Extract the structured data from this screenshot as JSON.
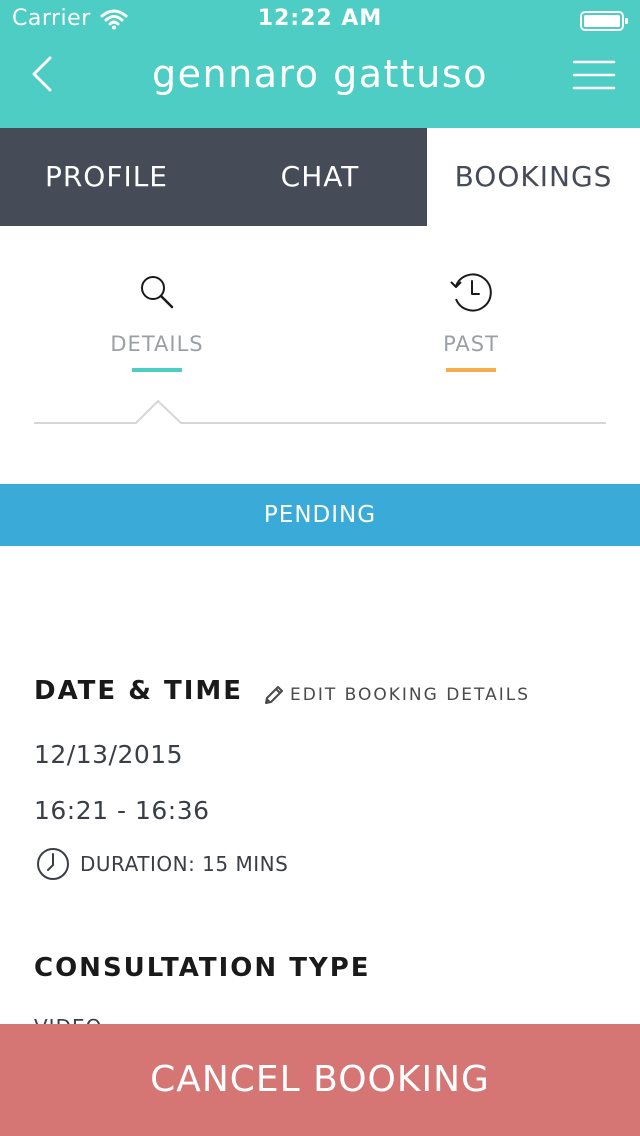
{
  "status_bar": {
    "carrier": "Carrier",
    "time": "12:22 AM",
    "wifi_icon": "wifi-icon",
    "battery_icon": "battery-icon"
  },
  "nav_bar": {
    "title": "gennaro gattuso",
    "back_icon": "chevron-left-icon",
    "menu_icon": "hamburger-menu-icon",
    "background_color": "#4ecdc4"
  },
  "tabs": [
    {
      "label": "PROFILE",
      "active": false
    },
    {
      "label": "CHAT",
      "active": false
    },
    {
      "label": "BOOKINGS",
      "active": true
    }
  ],
  "subtabs": [
    {
      "label": "DETAILS",
      "icon": "search-icon",
      "active": true,
      "accent": "#4ecdc4"
    },
    {
      "label": "PAST",
      "icon": "history-icon",
      "active": false,
      "accent": "#f6ad4a"
    }
  ],
  "status_banner": {
    "text": "PENDING",
    "color": "#3aabd9"
  },
  "date_time": {
    "heading": "DATE & TIME",
    "edit_label": "EDIT BOOKING DETAILS",
    "edit_icon": "pencil-icon",
    "date": "12/13/2015",
    "time_range": "16:21 - 16:36",
    "duration_label": "DURATION: 15 MINS",
    "duration_icon": "clock-icon"
  },
  "consultation": {
    "heading": "CONSULTATION TYPE",
    "value": "VIDEO"
  },
  "cancel_button": {
    "label": "CANCEL BOOKING",
    "color": "#d57675"
  }
}
